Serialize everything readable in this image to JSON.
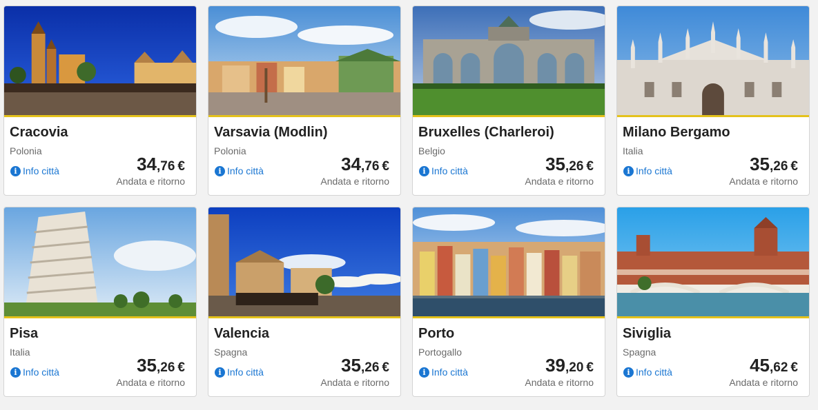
{
  "currency_symbol": "€",
  "info_label": "Info città",
  "trip_label": "Andata e ritorno",
  "accent_border_color": "#e4c21b",
  "link_color": "#1a76d2",
  "cards": [
    {
      "city": "Cracovia",
      "country": "Polonia",
      "price_int": "34",
      "price_dec": ",76",
      "photo": "krakow-market-square-night"
    },
    {
      "city": "Varsavia (Modlin)",
      "country": "Polonia",
      "price_int": "34",
      "price_dec": ",76",
      "photo": "warsaw-old-town-square"
    },
    {
      "city": "Bruxelles (Charleroi)",
      "country": "Belgio",
      "price_int": "35",
      "price_dec": ",26",
      "photo": "brussels-cinquantenaire-arch"
    },
    {
      "city": "Milano Bergamo",
      "country": "Italia",
      "price_int": "35",
      "price_dec": ",26",
      "photo": "milan-duomo-facade"
    },
    {
      "city": "Pisa",
      "country": "Italia",
      "price_int": "35",
      "price_dec": ",26",
      "photo": "pisa-leaning-tower"
    },
    {
      "city": "Valencia",
      "country": "Spagna",
      "price_int": "35",
      "price_dec": ",26",
      "photo": "valencia-plaza-carriages"
    },
    {
      "city": "Porto",
      "country": "Portogallo",
      "price_int": "39",
      "price_dec": ",20",
      "photo": "porto-riverside-houses"
    },
    {
      "city": "Siviglia",
      "country": "Spagna",
      "price_int": "45",
      "price_dec": ",62",
      "photo": "seville-plaza-de-espana"
    }
  ]
}
